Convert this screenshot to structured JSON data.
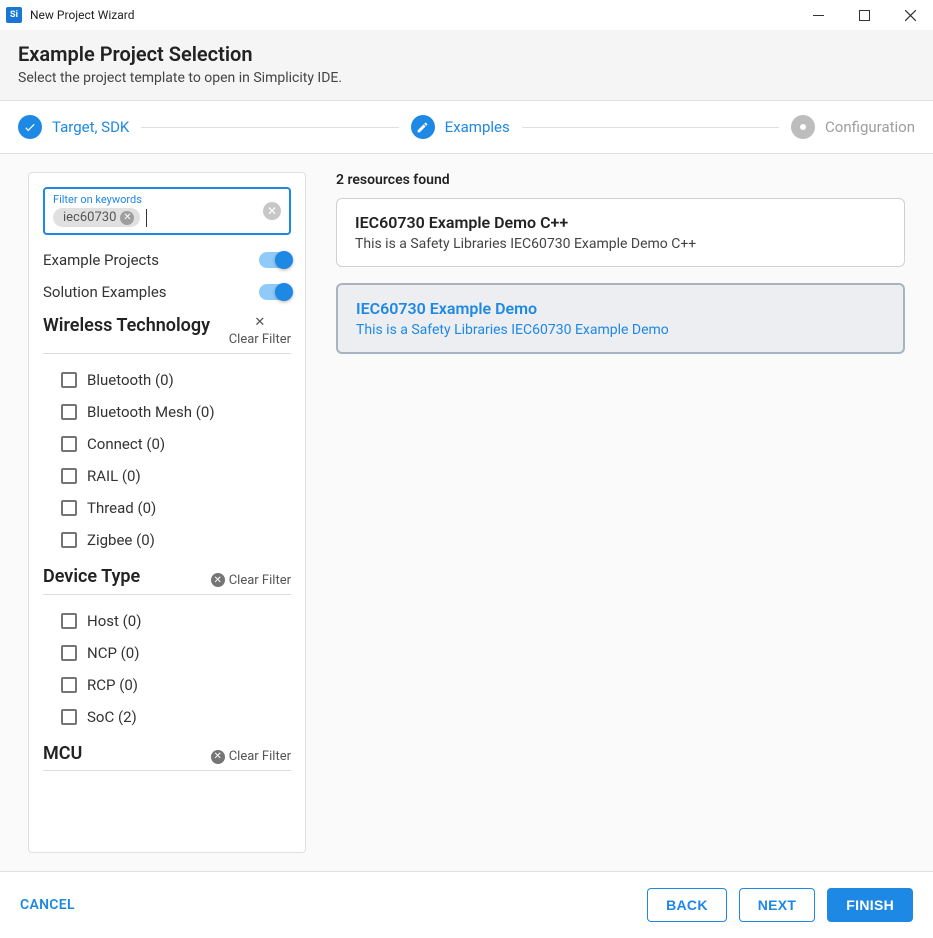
{
  "window": {
    "title": "New Project Wizard",
    "icon_text": "Si"
  },
  "header": {
    "title": "Example Project Selection",
    "subtitle": "Select the project template to open in Simplicity IDE."
  },
  "steps": {
    "s1": "Target, SDK",
    "s2": "Examples",
    "s3": "Configuration"
  },
  "search": {
    "label": "Filter on keywords",
    "chip": "iec60730"
  },
  "toggles": {
    "example_projects": "Example Projects",
    "solution_examples": "Solution Examples"
  },
  "filters": {
    "wireless": {
      "title": "Wireless Technology",
      "clear": "Clear Filter",
      "items": [
        "Bluetooth (0)",
        "Bluetooth Mesh (0)",
        "Connect (0)",
        "RAIL (0)",
        "Thread (0)",
        "Zigbee (0)"
      ]
    },
    "device": {
      "title": "Device Type",
      "clear": "Clear Filter",
      "items": [
        "Host (0)",
        "NCP (0)",
        "RCP (0)",
        "SoC (2)"
      ]
    },
    "mcu": {
      "title": "MCU",
      "clear": "Clear Filter"
    }
  },
  "results": {
    "count": "2 resources found",
    "items": [
      {
        "title": "IEC60730 Example Demo C++",
        "desc": "This is a Safety Libraries IEC60730 Example Demo C++"
      },
      {
        "title": "IEC60730 Example Demo",
        "desc": "This is a Safety Libraries IEC60730 Example Demo"
      }
    ]
  },
  "footer": {
    "cancel": "CANCEL",
    "back": "BACK",
    "next": "NEXT",
    "finish": "FINISH"
  }
}
